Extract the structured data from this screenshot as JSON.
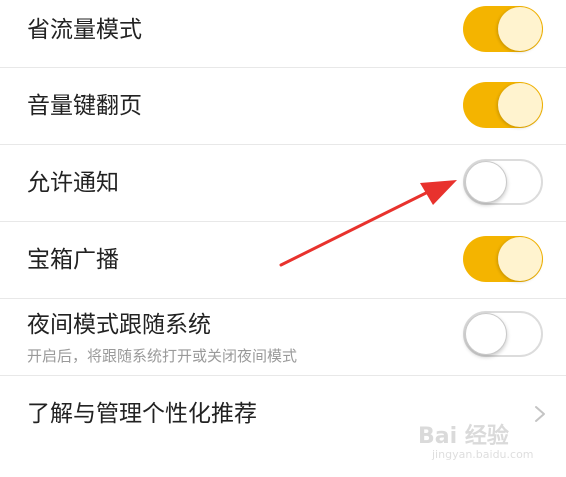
{
  "settings": [
    {
      "label": "省流量模式",
      "state": "on"
    },
    {
      "label": "音量键翻页",
      "state": "on"
    },
    {
      "label": "允许通知",
      "state": "off"
    },
    {
      "label": "宝箱广播",
      "state": "on"
    },
    {
      "label": "夜间模式跟随系统",
      "sublabel": "开启后，将跟随系统打开或关闭夜间模式",
      "state": "off"
    },
    {
      "label": "了解与管理个性化推荐"
    }
  ],
  "colors": {
    "toggle_on": "#f4b400",
    "knob_on": "#fff3cf",
    "annotation_arrow": "#e8322d"
  },
  "icons": {
    "row_6": "chevron-right-icon",
    "annotation": "red-arrow-annotation"
  },
  "watermark": {
    "text": "Bai 经验",
    "url": "jingyan.baidu.com"
  }
}
